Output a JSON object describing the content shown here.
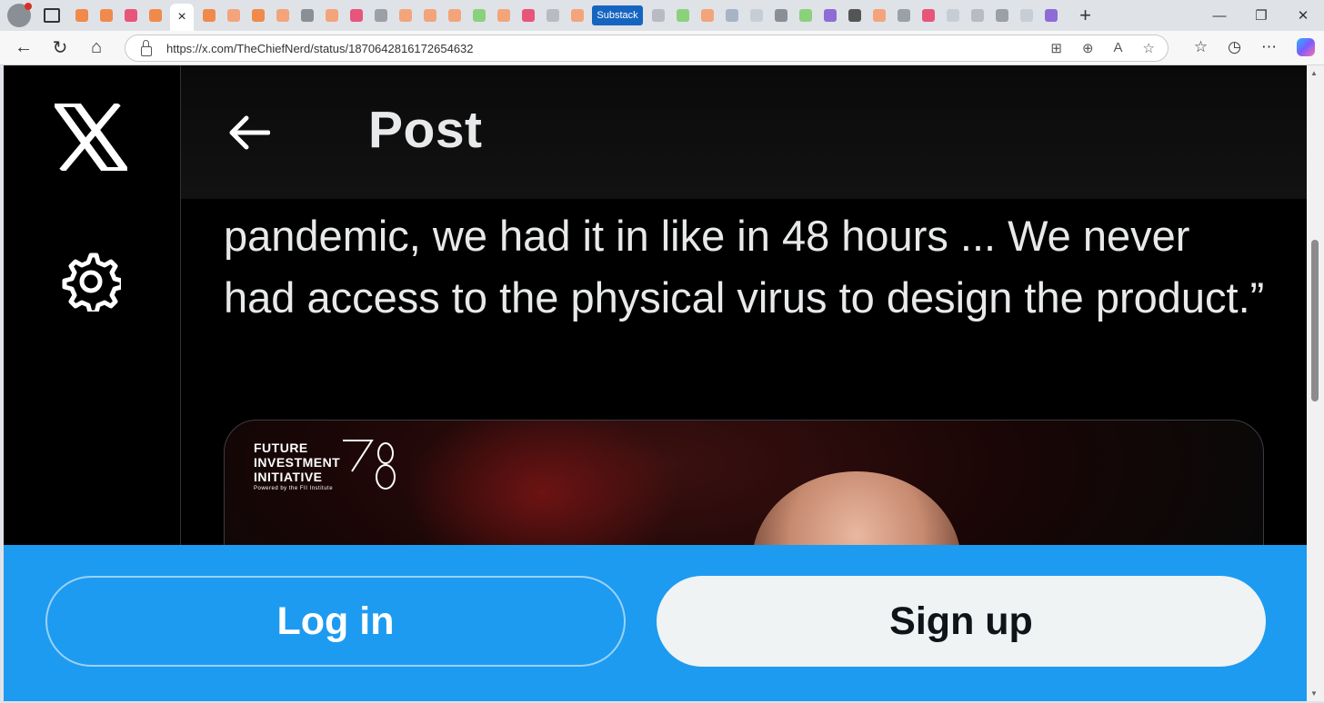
{
  "browser": {
    "url": "https://x.com/TheChiefNerd/status/1870642816172654632",
    "tab_active_close": "×",
    "substack_tab_label": "Substack",
    "notification_badge": "1"
  },
  "header": {
    "title": "Post"
  },
  "tweet": {
    "text": "pandemic, we had it in like in 48 hours ... We never had access to the physical virus to design the product.”"
  },
  "media": {
    "logo_text_lines": [
      "FUTURE",
      "INVESTMENT",
      "INITIATIVE"
    ],
    "logo_subtext": "Powered by the FII Institute"
  },
  "auth": {
    "login_label": "Log in",
    "signup_label": "Sign up"
  },
  "colors": {
    "accent": "#1d9bf0",
    "page_bg": "#000000",
    "text": "#e7e9ea"
  }
}
